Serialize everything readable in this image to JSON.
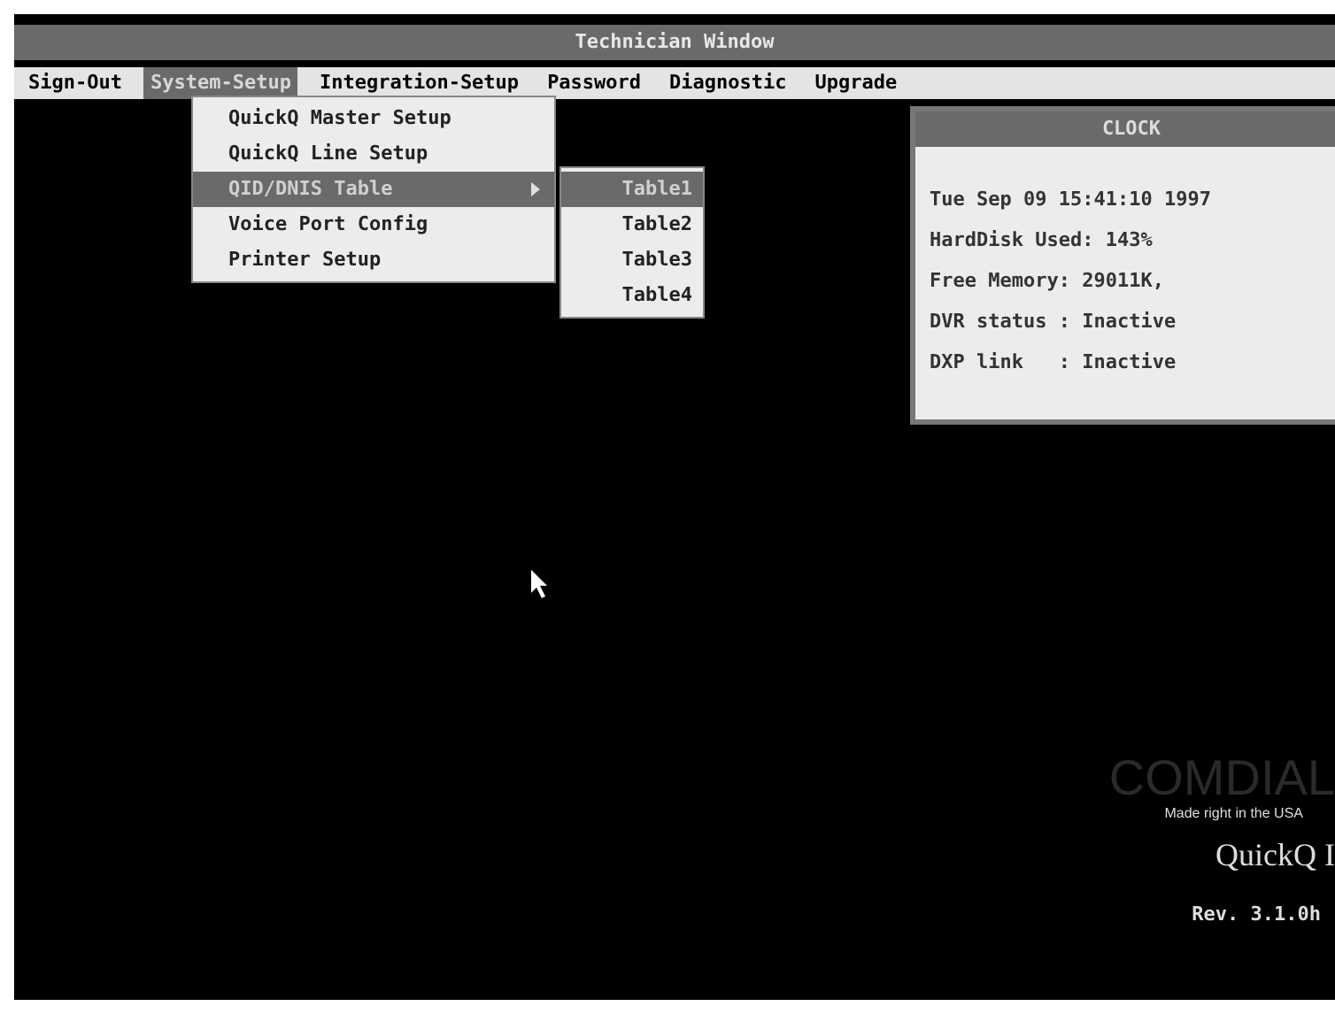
{
  "window": {
    "title": "Technician Window"
  },
  "menu_bar": [
    {
      "label": "Sign-Out",
      "selected": false
    },
    {
      "label": "System-Setup",
      "selected": true
    },
    {
      "label": "Integration-Setup",
      "selected": false
    },
    {
      "label": "Password",
      "selected": false
    },
    {
      "label": "Diagnostic",
      "selected": false
    },
    {
      "label": "Upgrade",
      "selected": false
    }
  ],
  "dropdown": [
    {
      "label": "QuickQ Master Setup",
      "selected": false,
      "submenu": false
    },
    {
      "label": "QuickQ Line Setup",
      "selected": false,
      "submenu": false
    },
    {
      "label": "QID/DNIS Table",
      "selected": true,
      "submenu": true
    },
    {
      "label": "Voice Port Config",
      "selected": false,
      "submenu": false
    },
    {
      "label": "Printer Setup",
      "selected": false,
      "submenu": false
    }
  ],
  "submenu": [
    {
      "label": "Table1",
      "selected": true
    },
    {
      "label": "Table2",
      "selected": false
    },
    {
      "label": "Table3",
      "selected": false
    },
    {
      "label": "Table4",
      "selected": false
    }
  ],
  "clock": {
    "title": "CLOCK",
    "lines": [
      "Tue Sep 09 15:41:10 1997",
      "HardDisk Used: 143%",
      "Free Memory: 29011K,",
      "DVR status : Inactive",
      "DXP link   : Inactive"
    ]
  },
  "branding": {
    "logo": "COMDIAL",
    "tagline": "Made right in the USA",
    "product": "QuickQ I",
    "revision": "Rev. 3.1.0h"
  }
}
